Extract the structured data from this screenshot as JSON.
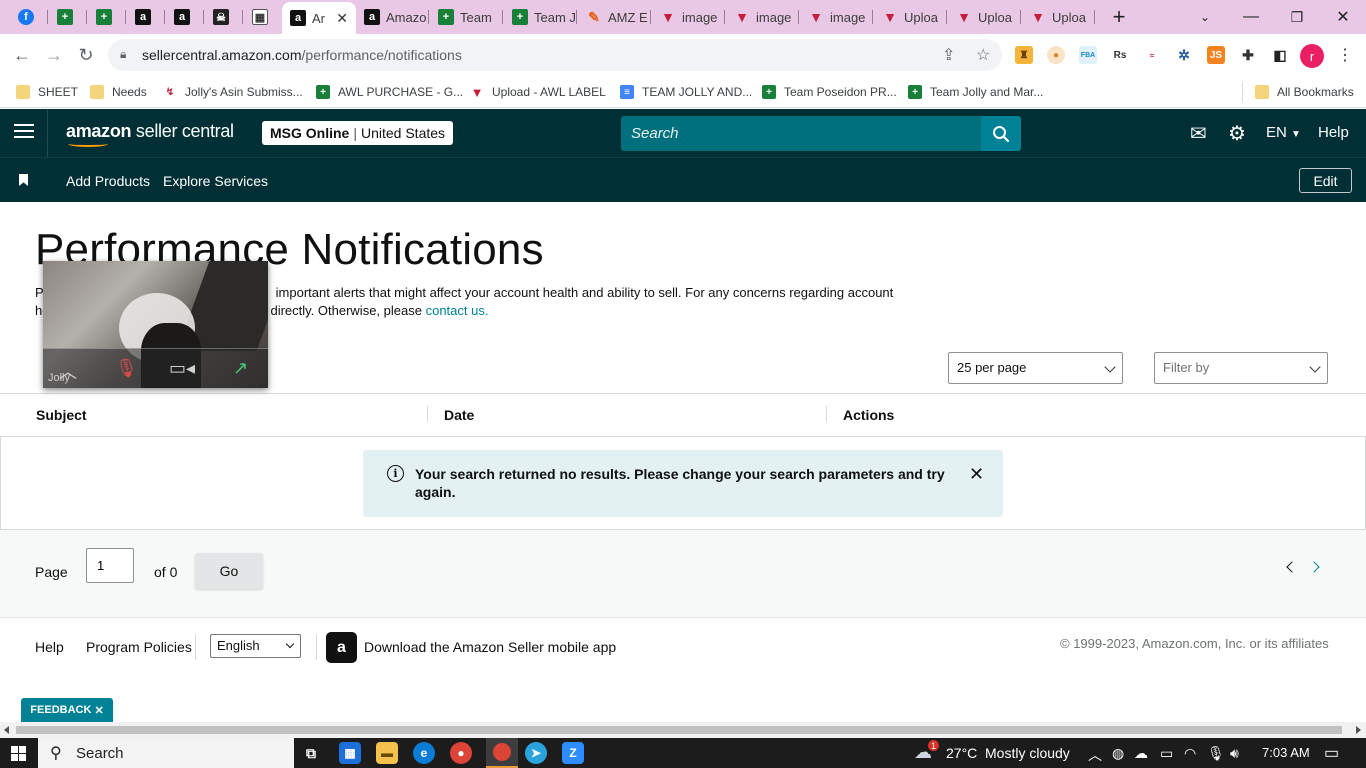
{
  "browser": {
    "tabs": [
      {
        "icon": "facebook-icon",
        "title": ""
      },
      {
        "icon": "google-sheets-icon",
        "title": ""
      },
      {
        "icon": "google-sheets-icon",
        "title": ""
      },
      {
        "icon": "amazon-icon",
        "title": ""
      },
      {
        "icon": "amazon-icon",
        "title": ""
      },
      {
        "icon": "skull-icon",
        "title": ""
      },
      {
        "icon": "calculator-icon",
        "title": ""
      },
      {
        "icon": "amazon-icon",
        "title": "Ar"
      },
      {
        "icon": "amazon-icon",
        "title": "Amazo"
      },
      {
        "icon": "google-sheets-icon",
        "title": "Team"
      },
      {
        "icon": "google-sheets-icon",
        "title": "Team J"
      },
      {
        "icon": "amz-tool-icon",
        "title": "AMZ E"
      },
      {
        "icon": "red-triangle-icon",
        "title": "image"
      },
      {
        "icon": "red-triangle-icon",
        "title": "image"
      },
      {
        "icon": "red-triangle-icon",
        "title": "image"
      },
      {
        "icon": "red-triangle-icon",
        "title": "Uploa"
      },
      {
        "icon": "red-triangle-icon",
        "title": "Uploa"
      },
      {
        "icon": "red-triangle-icon",
        "title": "Uploa"
      }
    ],
    "url_host": "sellercentral.amazon.com",
    "url_path": "/performance/notifications",
    "profile_initial": "r",
    "bookmarks": [
      {
        "icon": "folder",
        "label": "SHEET"
      },
      {
        "icon": "folder",
        "label": "Needs"
      },
      {
        "icon": "app",
        "label": "Jolly's Asin Submiss..."
      },
      {
        "icon": "sheet",
        "label": "AWL PURCHASE - G..."
      },
      {
        "icon": "red",
        "label": "Upload - AWL LABEL"
      },
      {
        "icon": "doc",
        "label": "TEAM JOLLY AND..."
      },
      {
        "icon": "sheet",
        "label": "Team Poseidon PR..."
      },
      {
        "icon": "sheet",
        "label": "Team Jolly and Mar..."
      }
    ],
    "all_bookmarks": "All Bookmarks"
  },
  "header": {
    "logo_bold": "amazon",
    "logo_light": " seller central",
    "account_name": "MSG Online",
    "account_region": "United States",
    "search_placeholder": "Search",
    "language": "EN",
    "help": "Help"
  },
  "subnav": {
    "add_products": "Add Products",
    "explore_services": "Explore Services",
    "edit": "Edit"
  },
  "page": {
    "title": "Performance Notifications",
    "desc_line1_visible": "important alerts that might affect your account health and ability to sell. For any concerns regarding account",
    "desc_line2_visible": "directly. Otherwise, please",
    "contact_link": "contact us.",
    "desc_p": "P",
    "desc_he": "he",
    "per_page": "25 per page",
    "filter_placeholder": "Filter by"
  },
  "table": {
    "columns": [
      "Subject",
      "Date",
      "Actions"
    ],
    "empty_message": "Your search returned no results. Please change your search parameters and try again."
  },
  "pagination": {
    "page_label": "Page",
    "current_page": "1",
    "of_label": "of 0",
    "go": "Go"
  },
  "footer": {
    "help": "Help",
    "program_policies": "Program Policies",
    "language_selected": "English",
    "app_promo": "Download the Amazon Seller mobile app",
    "copyright": "© 1999-2023, Amazon.com, Inc. or its affiliates",
    "feedback": "FEEDBACK"
  },
  "video_overlay": {
    "participant": "Jolly"
  },
  "taskbar": {
    "search": "Search",
    "weather_temp": "27°C",
    "weather_text": "Mostly cloudy",
    "weather_badge": "1",
    "time": "7:03 AM"
  },
  "colors": {
    "header_bg": "#002f36",
    "search_bg": "#00707d",
    "search_btn": "#008296",
    "link": "#008296",
    "alert_bg": "#e3f1f2",
    "tabstrip_bg": "#e8c8e4"
  }
}
